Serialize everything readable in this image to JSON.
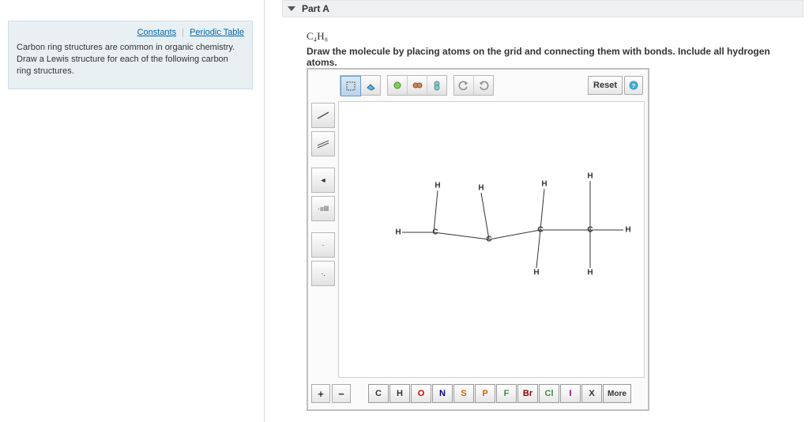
{
  "header": {
    "part_label": "Part A"
  },
  "links": {
    "constants": "Constants",
    "periodic": "Periodic Table"
  },
  "left": {
    "description": "Carbon ring structures are common in organic chemistry. Draw a Lewis structure for each of the following carbon ring structures."
  },
  "formula": {
    "html": "C₄H₈"
  },
  "instruction": "Draw the molecule by placing atoms on the grid and connecting them with bonds. Include all hydrogen atoms.",
  "buttons": {
    "reset": "Reset",
    "more": "More",
    "plus": "+",
    "minus": "−"
  },
  "elements": [
    "C",
    "H",
    "O",
    "N",
    "S",
    "P",
    "F",
    "Br",
    "Cl",
    "I",
    "X"
  ],
  "atoms": {
    "h1": "H",
    "h2": "H",
    "h3": "H",
    "h4": "H",
    "h5": "H",
    "h6": "H",
    "h7": "H",
    "h8": "H",
    "c1": "C",
    "c2": "C",
    "c3": "C",
    "c4": "C"
  },
  "side_labels": {
    "wedge": "◄",
    "bars": "▬",
    "dots": "·ıılll",
    "dot": "·",
    "dd": "·."
  }
}
